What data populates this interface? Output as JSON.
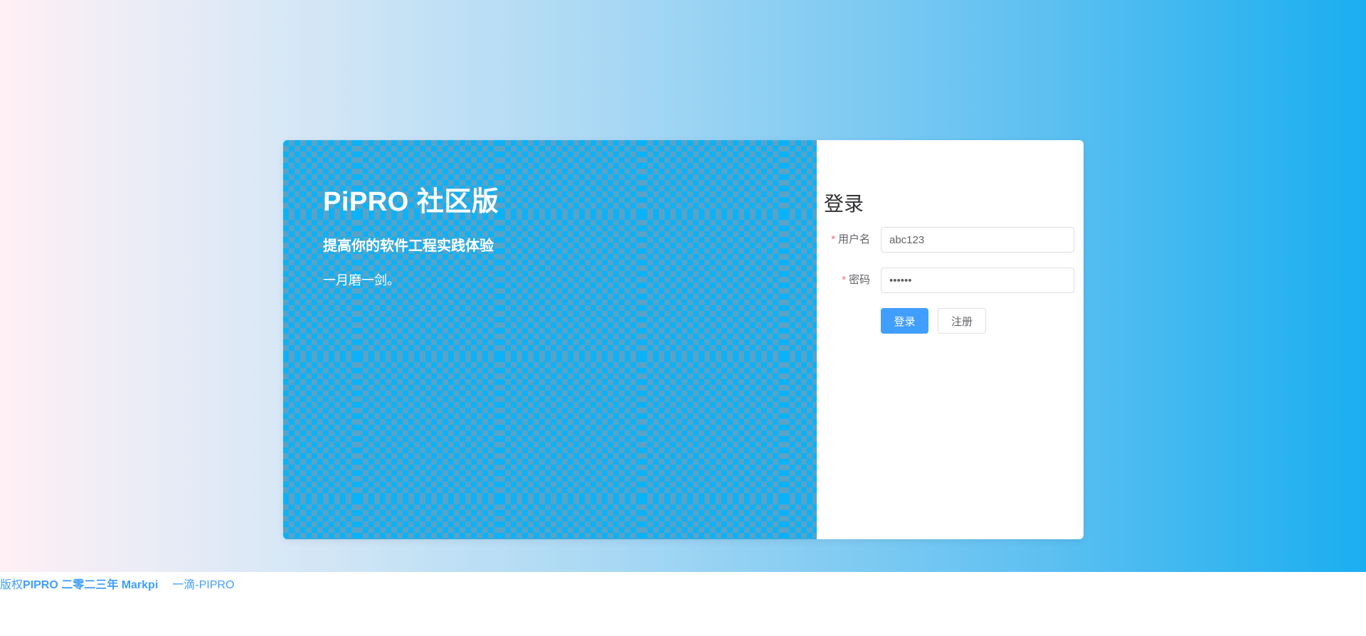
{
  "hero": {
    "title": "PiPRO 社区版",
    "subtitle": "提高你的软件工程实践体验",
    "motto": "一月磨一剑。"
  },
  "login": {
    "title": "登录",
    "username_label": "用户名",
    "username_value": "abc123",
    "password_label": "密码",
    "password_value": "••••••",
    "required_mark": "*",
    "login_button": "登录",
    "register_button": "注册"
  },
  "footer": {
    "prefix": "版权",
    "brand": "PIPRO 二零二三年 Markpi",
    "link": "一滴-PIPRO"
  },
  "colors": {
    "accent": "#409eff",
    "hero_blue": "#0bb2f7",
    "hero_pattern": "#5aa2c6",
    "required": "#f56c6c"
  }
}
